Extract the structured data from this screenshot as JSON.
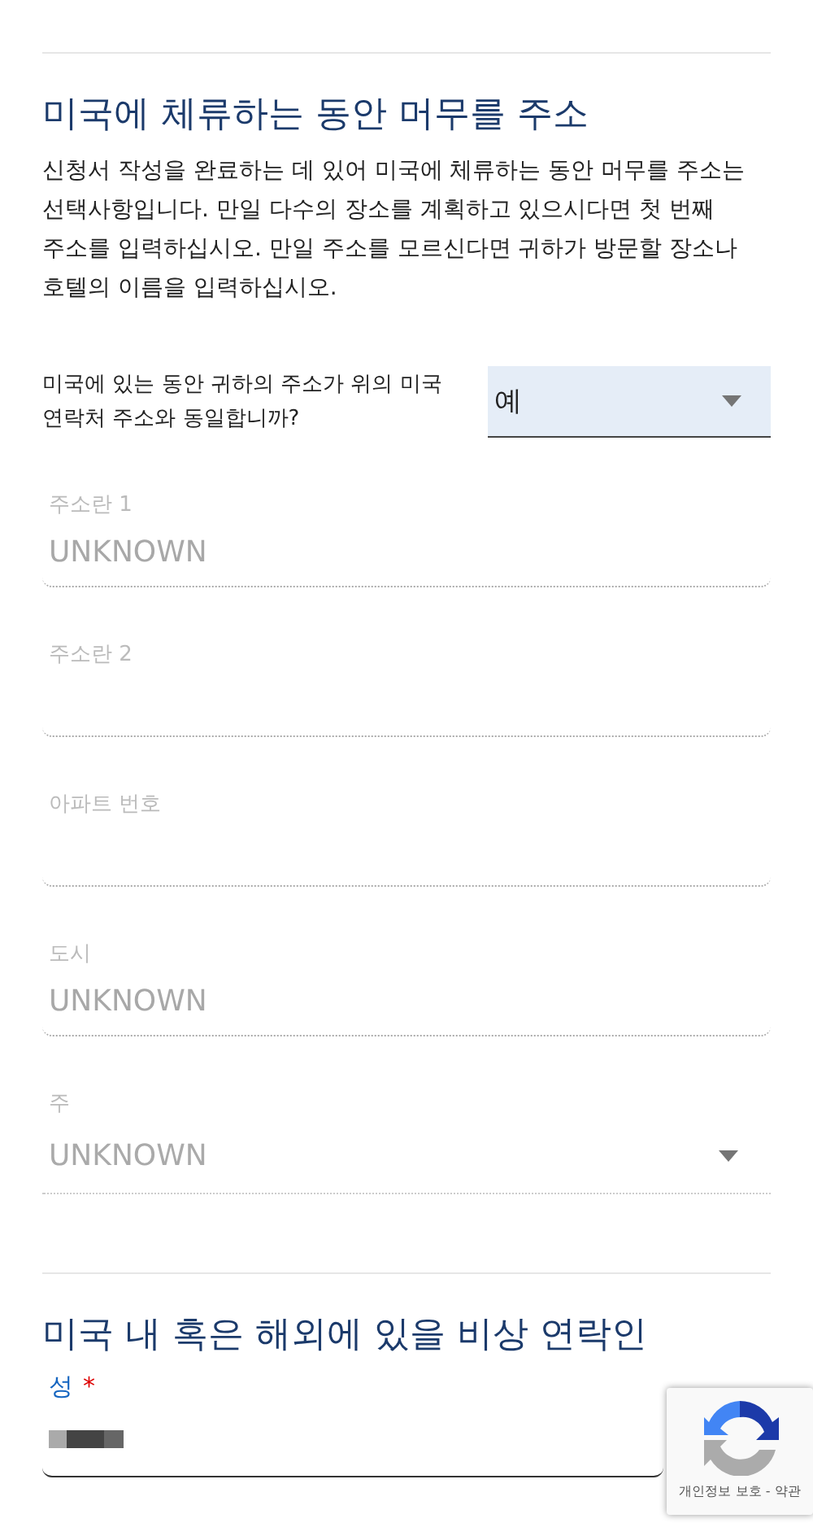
{
  "section_1": {
    "heading": "미국에 체류하는 동안 머무를 주소",
    "intro": "신청서 작성을 완료하는 데 있어 미국에 체류하는 동안 머무를 주소는 선택사항입니다. 만일 다수의 장소를 계획하고 있으시다면 첫 번째 주소를 입력하십시오. 만일 주소를 모르신다면 귀하가 방문할 장소나 호텔의 이름을 입력하십시오.",
    "question": {
      "label": "미국에 있는 동안 귀하의 주소가 위의 미국 연락처 주소와 동일합니까?",
      "value": "예"
    },
    "fields": [
      {
        "kind": "input",
        "label": "주소란 1",
        "placeholder": "UNKNOWN",
        "disabled": true
      },
      {
        "kind": "input",
        "label": "주소란 2",
        "disabled": true
      },
      {
        "kind": "input",
        "label": "아파트 번호",
        "disabled": true
      },
      {
        "kind": "input",
        "label": "도시",
        "placeholder": "UNKNOWN",
        "disabled": true
      },
      {
        "kind": "select",
        "label": "주",
        "value": "UNKNOWN",
        "disabled": true
      }
    ]
  },
  "section_2": {
    "heading": "미국 내 혹은 해외에 있을 비상 연락인",
    "fields": [
      {
        "kind": "input",
        "label": "성",
        "required": true,
        "required_mark": "*",
        "redacted": true
      }
    ]
  },
  "recaptcha": {
    "links": "개인정보 보호 - 약관"
  }
}
